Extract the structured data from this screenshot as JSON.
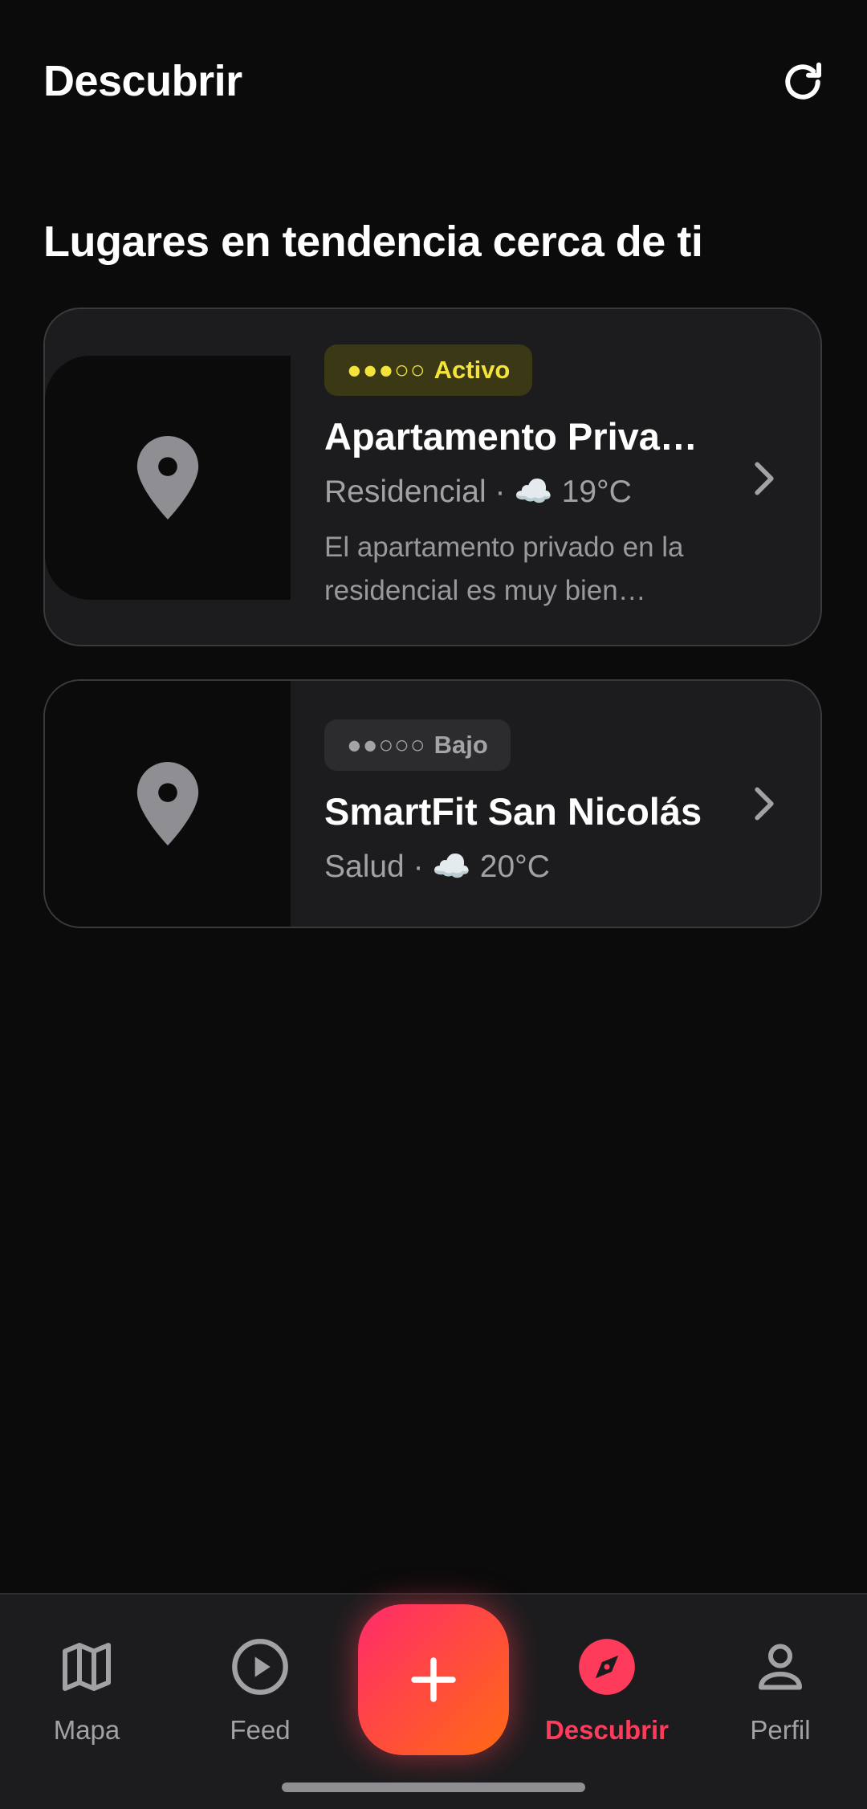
{
  "header": {
    "title": "Descubrir",
    "refresh_icon": "refresh-icon"
  },
  "section": {
    "title": "Lugares en tendencia cerca de ti"
  },
  "places": [
    {
      "badge_dots": "●●●○○",
      "badge_label": "Activo",
      "badge_color": "#f4e33a",
      "name": "Apartamento Privado en la Residencial",
      "meta": "Residencial · ☁️ 19°C",
      "description": "El apartamento privado en la residencial es muy bien ubicado"
    },
    {
      "badge_dots": "●●○○○",
      "badge_label": "Bajo",
      "badge_color": "#a3a3a8",
      "name": "SmartFit San Nicolás",
      "meta": "Salud · ☁️ 20°C"
    }
  ],
  "nav": {
    "items": [
      {
        "label": "Mapa",
        "icon": "map-icon"
      },
      {
        "label": "Feed",
        "icon": "play-circle-icon"
      },
      {
        "label": "Descubrir",
        "icon": "compass-icon",
        "active": true
      },
      {
        "label": "Perfil",
        "icon": "person-icon"
      }
    ],
    "fab_icon": "plus-icon",
    "accent_color": "#ff3b5c"
  }
}
